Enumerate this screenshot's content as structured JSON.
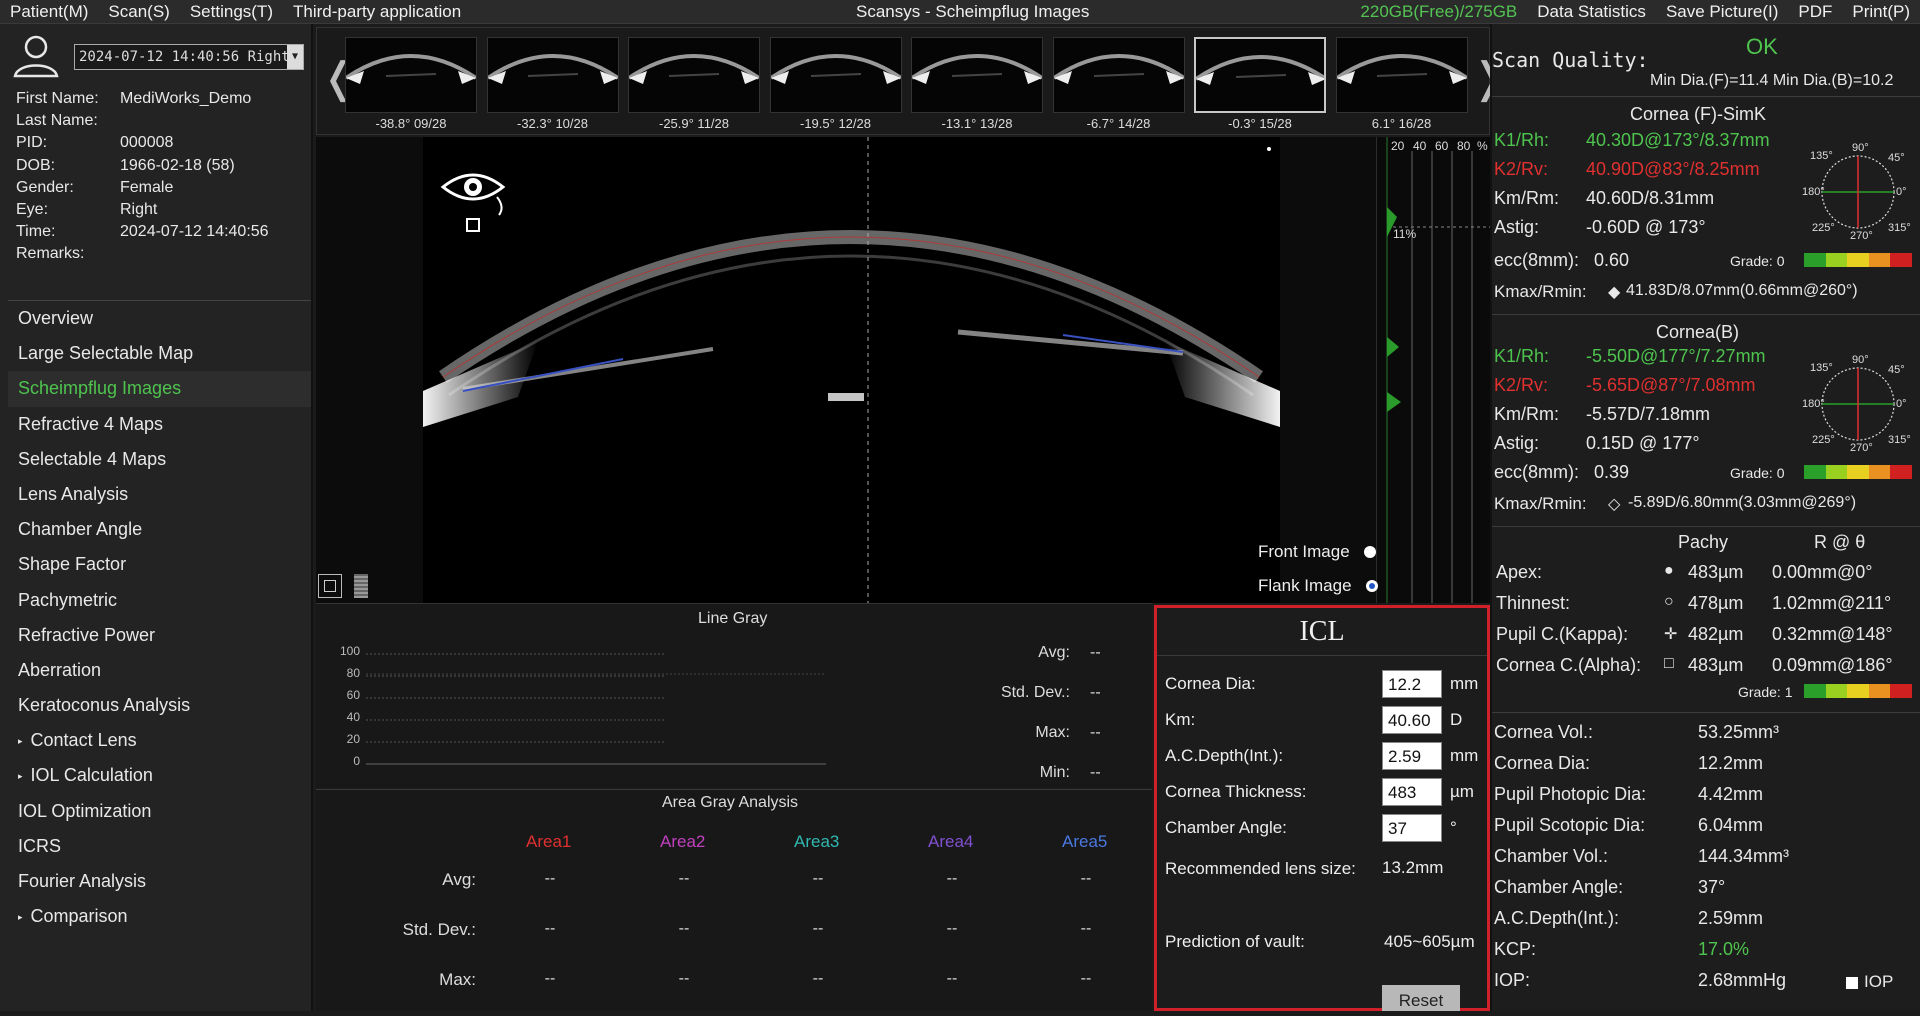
{
  "menu": {
    "items": [
      "Patient(M)",
      "Scan(S)",
      "Settings(T)",
      "Third-party application"
    ],
    "title": "Scansys - Scheimpflug Images",
    "storage": "220GB(Free)/275GB",
    "right_items": [
      "Data Statistics",
      "Save Picture(I)",
      "PDF",
      "Print(P)"
    ]
  },
  "patient": {
    "exam_selector": "2024-07-12 14:40:56 Right",
    "fields": [
      {
        "label": "First Name:",
        "value": "MediWorks_Demo"
      },
      {
        "label": "Last Name:",
        "value": ""
      },
      {
        "label": "PID:",
        "value": "000008"
      },
      {
        "label": "DOB:",
        "value": "1966-02-18  (58)"
      },
      {
        "label": "Gender:",
        "value": "Female"
      },
      {
        "label": "Eye:",
        "value": "Right"
      },
      {
        "label": "Time:",
        "value": "2024-07-12 14:40:56"
      },
      {
        "label": "Remarks:",
        "value": ""
      }
    ]
  },
  "nav": [
    {
      "label": "Overview",
      "expandable": false,
      "active": false
    },
    {
      "label": "Large Selectable Map",
      "expandable": false,
      "active": false
    },
    {
      "label": "Scheimpflug Images",
      "expandable": false,
      "active": true
    },
    {
      "label": "Refractive 4 Maps",
      "expandable": false,
      "active": false
    },
    {
      "label": "Selectable 4 Maps",
      "expandable": false,
      "active": false
    },
    {
      "label": "Lens Analysis",
      "expandable": false,
      "active": false
    },
    {
      "label": "Chamber Angle",
      "expandable": false,
      "active": false
    },
    {
      "label": "Shape Factor",
      "expandable": false,
      "active": false
    },
    {
      "label": "Pachymetric",
      "expandable": false,
      "active": false
    },
    {
      "label": "Refractive Power",
      "expandable": false,
      "active": false
    },
    {
      "label": "Aberration",
      "expandable": false,
      "active": false
    },
    {
      "label": "Keratoconus Analysis",
      "expandable": false,
      "active": false
    },
    {
      "label": "Contact Lens",
      "expandable": true,
      "active": false
    },
    {
      "label": "IOL Calculation",
      "expandable": true,
      "active": false
    },
    {
      "label": "IOL Optimization",
      "expandable": false,
      "active": false
    },
    {
      "label": "ICRS",
      "expandable": false,
      "active": false
    },
    {
      "label": "Fourier Analysis",
      "expandable": false,
      "active": false
    },
    {
      "label": "Comparison",
      "expandable": true,
      "active": false
    }
  ],
  "thumbnails": [
    {
      "caption": "-38.8°  09/28",
      "selected": false
    },
    {
      "caption": "-32.3°  10/28",
      "selected": false
    },
    {
      "caption": "-25.9°  11/28",
      "selected": false
    },
    {
      "caption": "-19.5°  12/28",
      "selected": false
    },
    {
      "caption": "-13.1°  13/28",
      "selected": false
    },
    {
      "caption": "-6.7°  14/28",
      "selected": false
    },
    {
      "caption": "-0.3°  15/28",
      "selected": true
    },
    {
      "caption": "6.1°  16/28",
      "selected": false
    }
  ],
  "viewer": {
    "front_image": "Front Image",
    "flank_image": "Flank Image",
    "selected": "Flank Image",
    "hist_ticks": [
      "20",
      "40",
      "60",
      "80",
      "%"
    ],
    "hist_marker": "11%"
  },
  "line_gray": {
    "title": "Line Gray",
    "y_ticks": [
      "100",
      "80",
      "60",
      "40",
      "20",
      "0"
    ],
    "stats": [
      {
        "label": "Avg:",
        "value": "--"
      },
      {
        "label": "Std. Dev.:",
        "value": "--"
      },
      {
        "label": "Max:",
        "value": "--"
      },
      {
        "label": "Min:",
        "value": "--"
      }
    ]
  },
  "area_gray": {
    "title": "Area Gray Analysis",
    "areas": [
      {
        "name": "Area1",
        "color": "#e03030"
      },
      {
        "name": "Area2",
        "color": "#c040c0"
      },
      {
        "name": "Area3",
        "color": "#30b8b0"
      },
      {
        "name": "Area4",
        "color": "#8050d0"
      },
      {
        "name": "Area5",
        "color": "#4a78e0"
      }
    ],
    "rows": [
      {
        "label": "Avg:",
        "values": [
          "--",
          "--",
          "--",
          "--",
          "--"
        ]
      },
      {
        "label": "Std. Dev.:",
        "values": [
          "--",
          "--",
          "--",
          "--",
          "--"
        ]
      },
      {
        "label": "Max:",
        "values": [
          "--",
          "--",
          "--",
          "--",
          "--"
        ]
      }
    ]
  },
  "icl": {
    "title": "ICL",
    "inputs": [
      {
        "label": "Cornea Dia:",
        "value": "12.2",
        "unit": "mm"
      },
      {
        "label": "Km:",
        "value": "40.60",
        "unit": "D"
      },
      {
        "label": "A.C.Depth(Int.):",
        "value": "2.59",
        "unit": "mm"
      },
      {
        "label": "Cornea Thickness:",
        "value": "483",
        "unit": "µm"
      },
      {
        "label": "Chamber Angle:",
        "value": "37",
        "unit": "°"
      }
    ],
    "recommended_label": "Recommended lens size:",
    "recommended_value": "13.2mm",
    "vault_label": "Prediction of vault:",
    "vault_value": "405~605µm",
    "reset": "Reset"
  },
  "right": {
    "scan_quality_label": "Scan Quality:",
    "scan_quality_value": "OK",
    "min_dia": "Min Dia.(F)=11.4   Min Dia.(B)=10.2",
    "front": {
      "title": "Cornea (F)-SimK",
      "rows": [
        {
          "label": "K1/Rh:",
          "value": "40.30D@173°/8.37mm",
          "color": "green"
        },
        {
          "label": "K2/Rv:",
          "value": "40.90D@83°/8.25mm",
          "color": "red"
        },
        {
          "label": "Km/Rm:",
          "value": "40.60D/8.31mm",
          "color": ""
        },
        {
          "label": "Astig:",
          "value": "-0.60D @ 173°",
          "color": ""
        }
      ],
      "ecc_label": "ecc(8mm):",
      "ecc_value": "0.60",
      "grade": "Grade: 0",
      "kmax_label": "Kmax/Rmin:",
      "kmax_value": "41.83D/8.07mm(0.66mm@260°)"
    },
    "back": {
      "title": "Cornea(B)",
      "rows": [
        {
          "label": "K1/Rh:",
          "value": "-5.50D@177°/7.27mm",
          "color": "green"
        },
        {
          "label": "K2/Rv:",
          "value": "-5.65D@87°/7.08mm",
          "color": "red"
        },
        {
          "label": "Km/Rm:",
          "value": "-5.57D/7.18mm",
          "color": ""
        },
        {
          "label": "Astig:",
          "value": "0.15D @ 177°",
          "color": ""
        }
      ],
      "ecc_label": "ecc(8mm):",
      "ecc_value": "0.39",
      "grade": "Grade: 0",
      "kmax_label": "Kmax/Rmin:",
      "kmax_value": "-5.89D/6.80mm(3.03mm@269°)"
    },
    "compass_labels": [
      "90°",
      "45°",
      "0°",
      "315°",
      "270°",
      "225°",
      "180°",
      "135°"
    ],
    "pachy": {
      "col1": "Pachy",
      "col2": "R @ θ",
      "rows": [
        {
          "label": "Apex:",
          "value": "483µm",
          "pos": "0.00mm@0°"
        },
        {
          "label": "Thinnest:",
          "value": "478µm",
          "pos": "1.02mm@211°"
        },
        {
          "label": "Pupil C.(Kappa):",
          "value": "482µm",
          "pos": "0.32mm@148°"
        },
        {
          "label": "Cornea C.(Alpha):",
          "value": "483µm",
          "pos": "0.09mm@186°"
        }
      ],
      "grade": "Grade: 1"
    },
    "summary": [
      {
        "label": "Cornea Vol.:",
        "value": "53.25mm³",
        "color": ""
      },
      {
        "label": "Cornea Dia:",
        "value": "12.2mm",
        "color": ""
      },
      {
        "label": "Pupil Photopic Dia:",
        "value": "4.42mm",
        "color": ""
      },
      {
        "label": "Pupil Scotopic Dia:",
        "value": "6.04mm",
        "color": ""
      },
      {
        "label": "Chamber Vol.:",
        "value": "144.34mm³",
        "color": ""
      },
      {
        "label": "Chamber Angle:",
        "value": "37°",
        "color": ""
      },
      {
        "label": "A.C.Depth(Int.):",
        "value": "2.59mm",
        "color": ""
      },
      {
        "label": "KCP:",
        "value": "17.0%",
        "color": "green"
      },
      {
        "label": "IOP:",
        "value": "2.68mmHg",
        "color": ""
      }
    ],
    "iop_check": "IOP"
  },
  "colors": {
    "accent_green": "#4ec44e",
    "alert_red": "#d0202a"
  }
}
